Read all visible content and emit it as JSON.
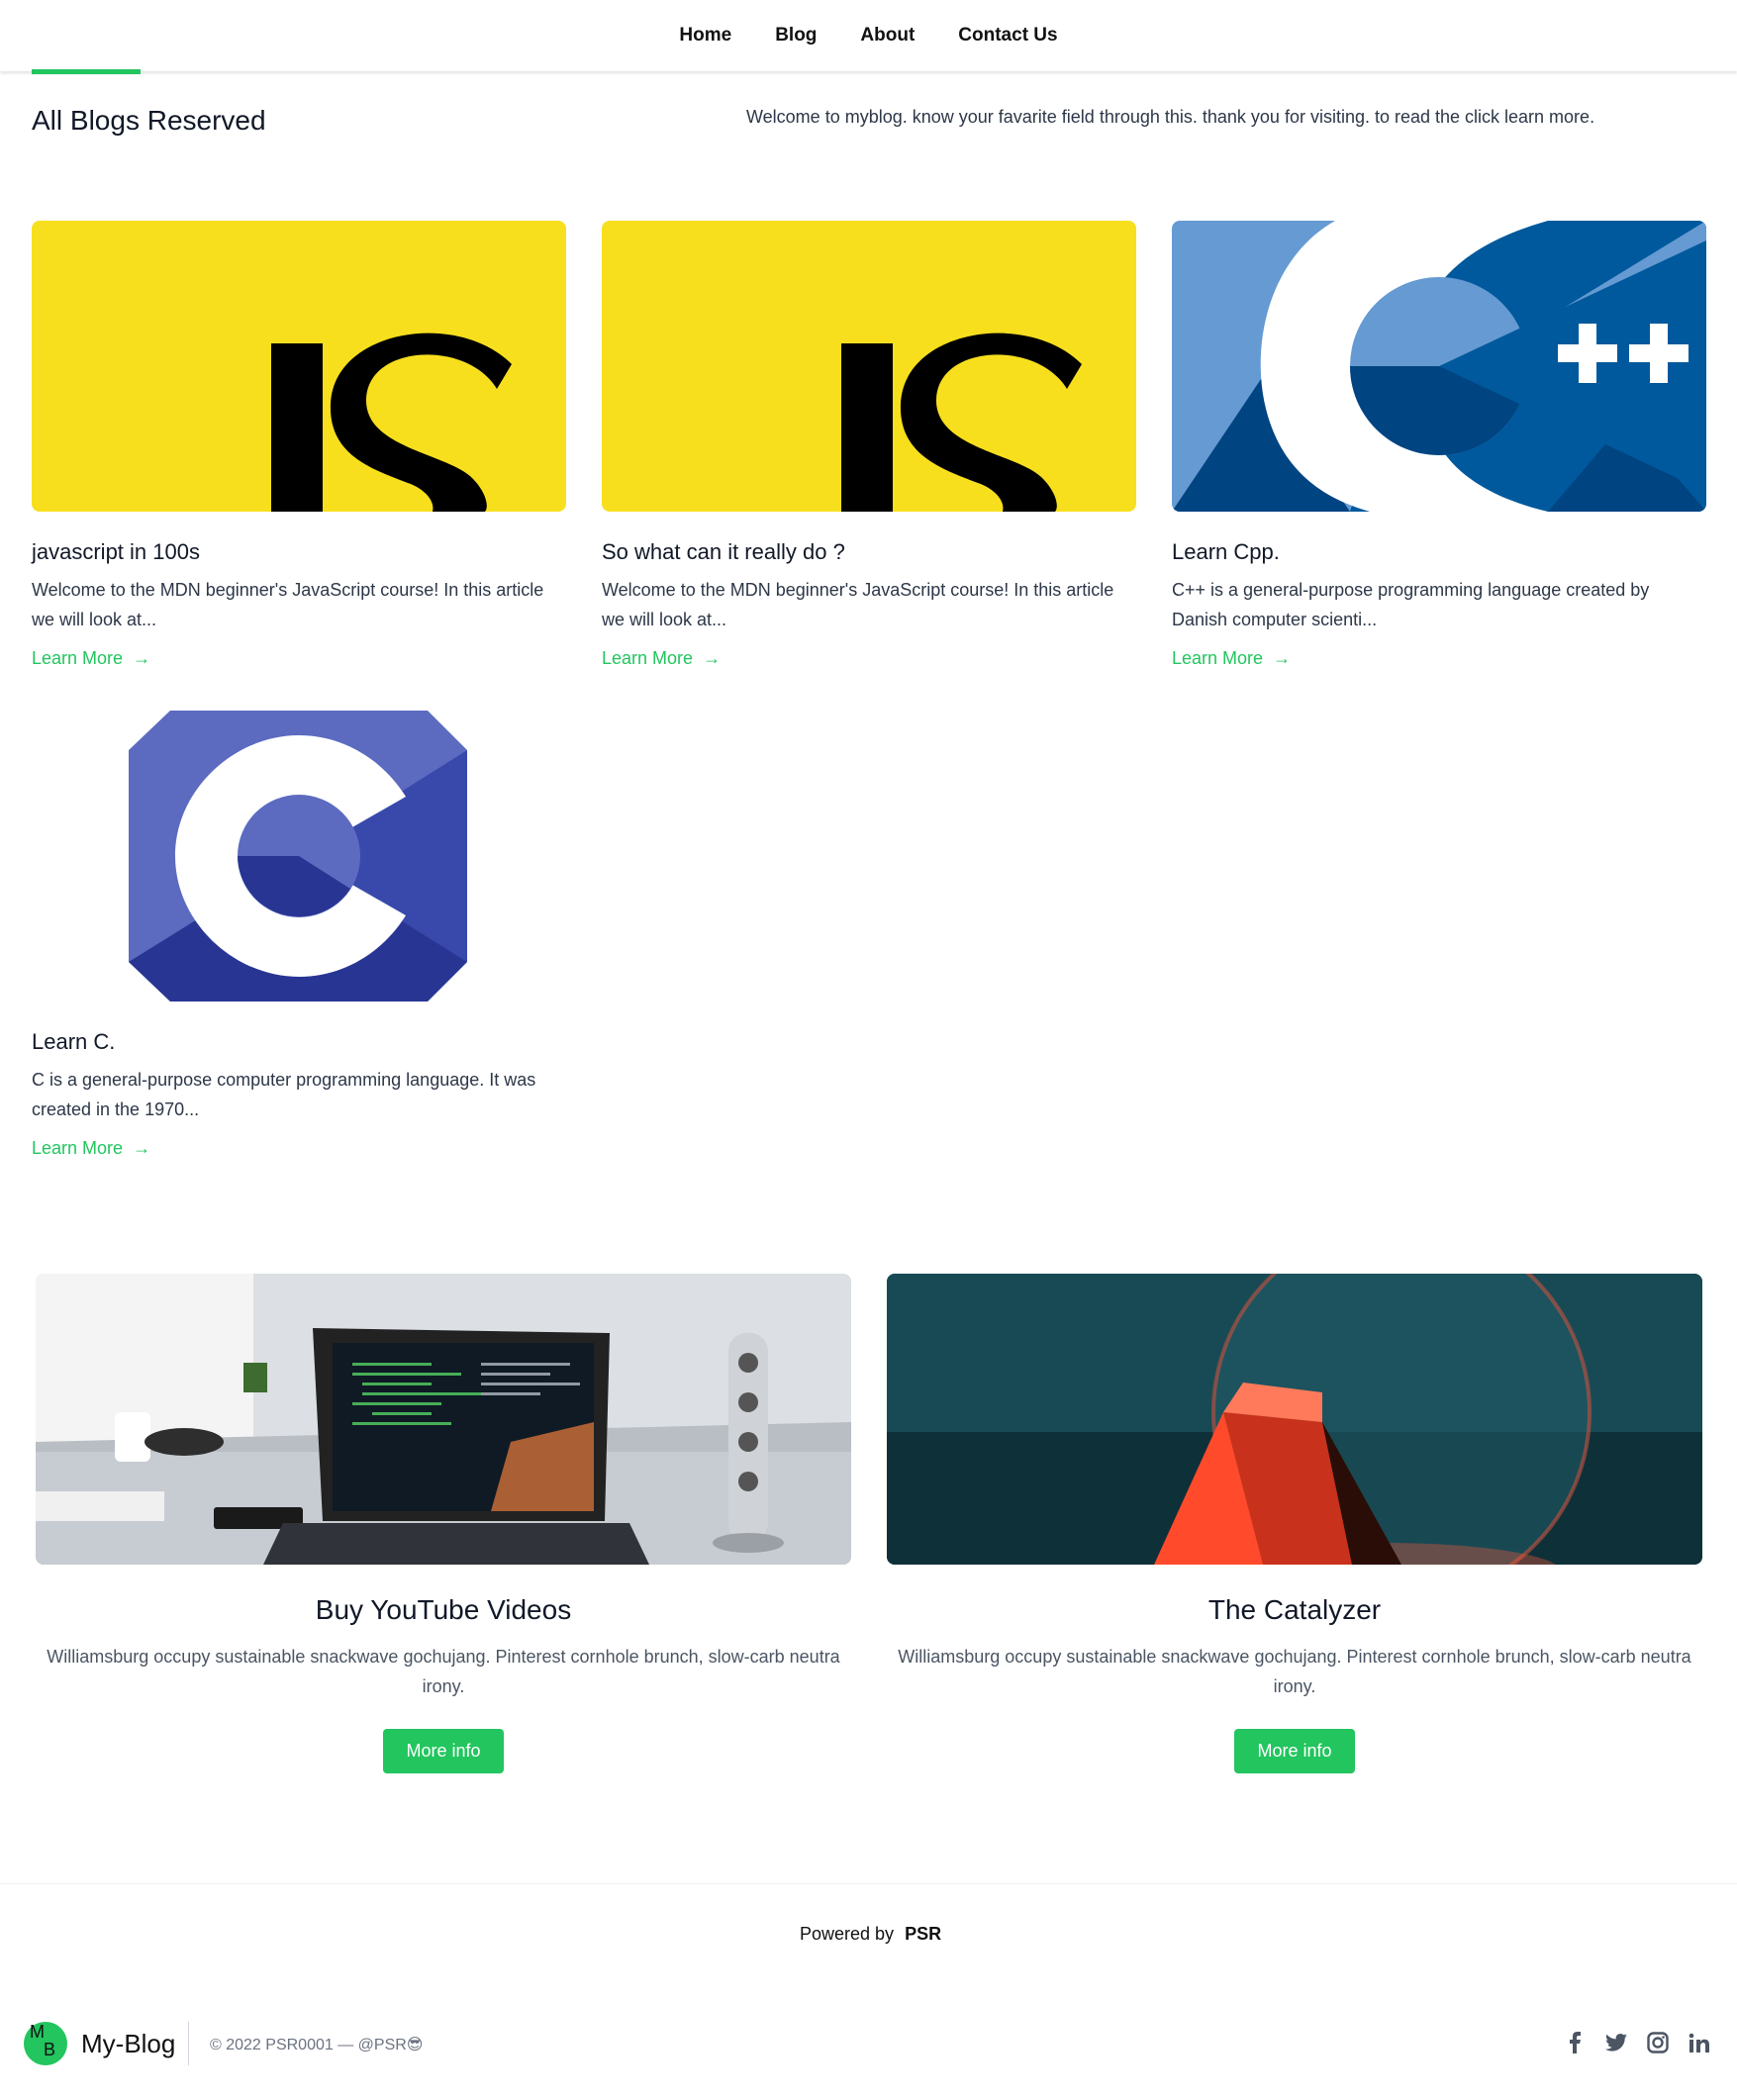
{
  "nav": {
    "items": [
      "Home",
      "Blog",
      "About",
      "Contact Us"
    ]
  },
  "page": {
    "title": "All Blogs Reserved",
    "intro": "Welcome to myblog. know your favarite field through this. thank you for visiting. to read the click learn more."
  },
  "posts": [
    {
      "title": "javascript in 100s",
      "excerpt": "Welcome to the MDN beginner's JavaScript course! In this article we will look at...",
      "link": "Learn More",
      "image_icon": "js-logo-image",
      "image_text": "JS"
    },
    {
      "title": "So what can it really do ?",
      "excerpt": "Welcome to the MDN beginner's JavaScript course! In this article we will look at...",
      "link": "Learn More",
      "image_icon": "js-logo-image",
      "image_text": "JS"
    },
    {
      "title": "Learn Cpp.",
      "excerpt": "C++ is a general-purpose programming language created by Danish computer scienti...",
      "link": "Learn More",
      "image_icon": "cpp-logo-image",
      "image_text": "++"
    },
    {
      "title": "Learn C.",
      "excerpt": "C is a general-purpose computer programming language. It was created in the 1970...",
      "link": "Learn More",
      "image_icon": "c-logo-image"
    }
  ],
  "features": [
    {
      "title": "Buy YouTube Videos",
      "text": "Williamsburg occupy sustainable snackwave gochujang. Pinterest cornhole brunch, slow-carb neutra irony.",
      "button": "More info",
      "image_icon": "laptop-desk-photo"
    },
    {
      "title": "The Catalyzer",
      "text": "Williamsburg occupy sustainable snackwave gochujang. Pinterest cornhole brunch, slow-carb neutra irony.",
      "button": "More info",
      "image_icon": "glass-sphere-photo"
    }
  ],
  "footer": {
    "powered_label": "Powered by",
    "powered_name": "PSR",
    "logo_letters": [
      "M",
      "B"
    ],
    "brand": "My-Blog",
    "copyright": "© 2022 PSR0001 — @PSR😎",
    "socials": [
      "facebook-icon",
      "twitter-icon",
      "instagram-icon",
      "linkedin-icon"
    ]
  },
  "colors": {
    "accent": "#22c55e",
    "js_yellow": "#f7df1e",
    "cpp_blue": "#00599c",
    "c_purple": "#3949ab"
  }
}
